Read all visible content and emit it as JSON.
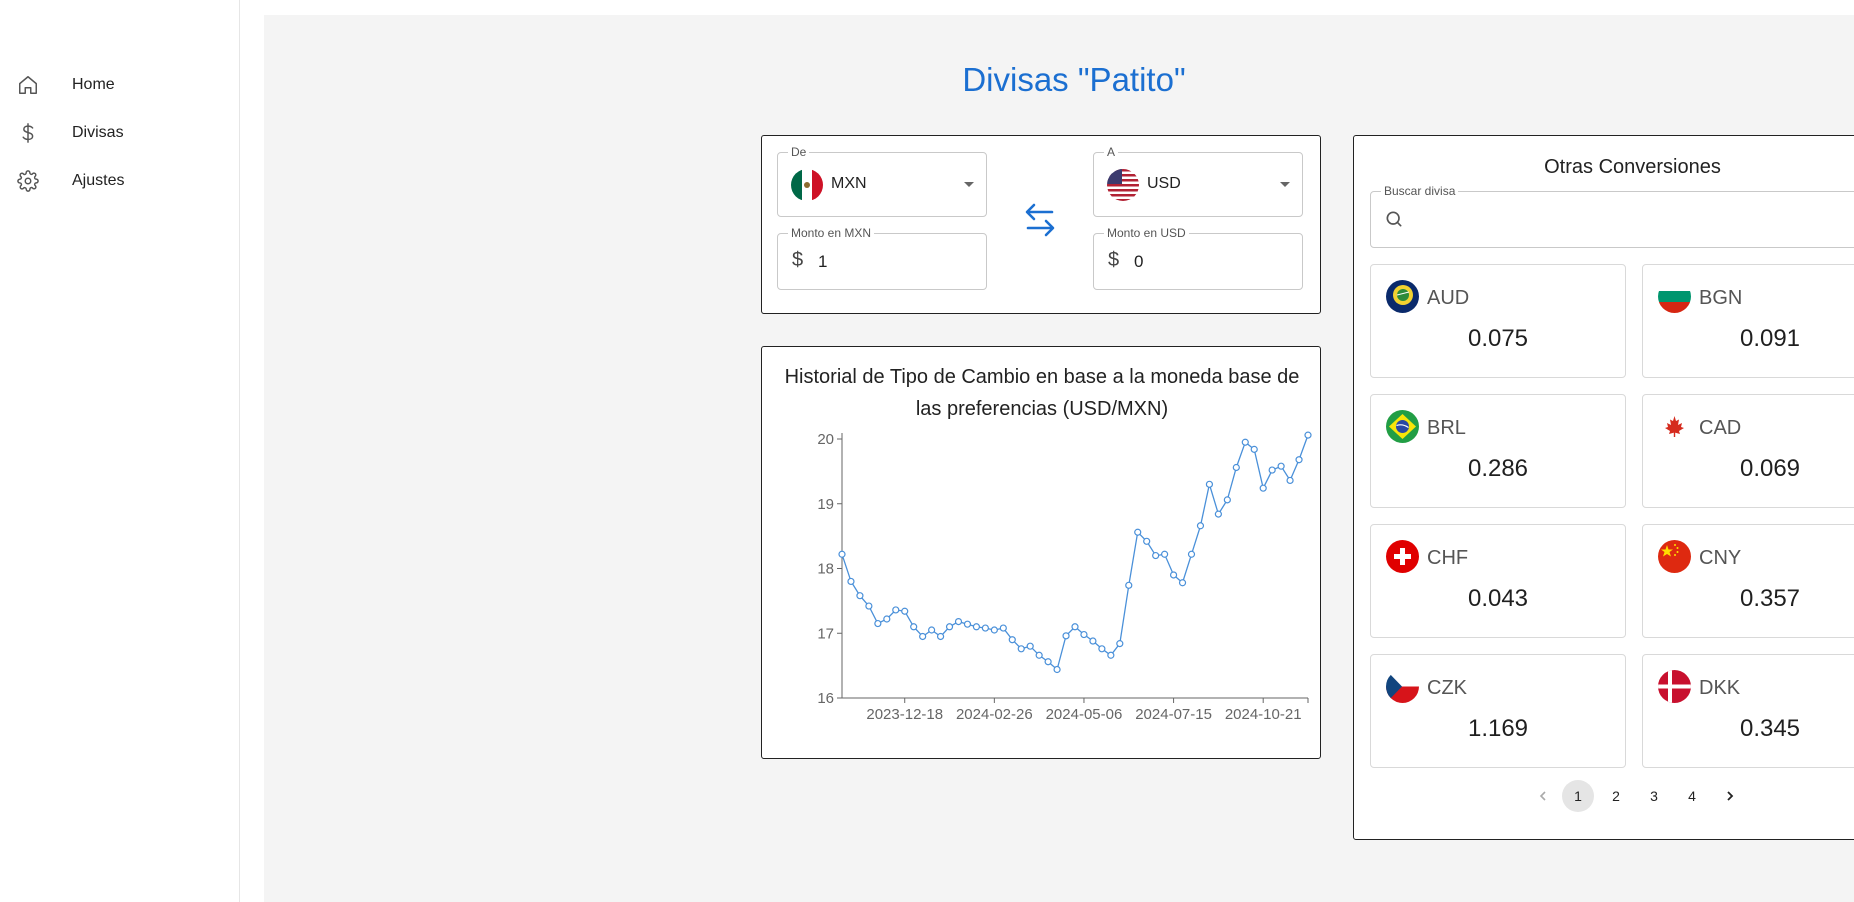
{
  "sidebar": {
    "items": [
      {
        "label": "Home",
        "icon": "home-icon"
      },
      {
        "label": "Divisas",
        "icon": "dollar-icon"
      },
      {
        "label": "Ajustes",
        "icon": "gear-icon"
      }
    ]
  },
  "page_title": "Divisas \"Patito\"",
  "converter": {
    "from": {
      "label": "De",
      "code": "MXN",
      "flag": "mexico-flag"
    },
    "to": {
      "label": "A",
      "code": "USD",
      "flag": "usa-flag"
    },
    "from_amount": {
      "label": "Monto en MXN",
      "symbol": "$",
      "value": "1"
    },
    "to_amount": {
      "label": "Monto en USD",
      "symbol": "$",
      "value": "0"
    },
    "swap_icon": "swap-arrows-icon"
  },
  "history": {
    "title_line1": "Historial de Tipo de Cambio en base a la moneda base de",
    "title_line2": "las preferencias (USD/MXN)"
  },
  "chart_data": {
    "type": "line",
    "title": "Historial de Tipo de Cambio en base a la moneda base de las preferencias (USD/MXN)",
    "xlabel": "",
    "ylabel": "",
    "ylim": [
      16,
      20
    ],
    "yticks": [
      "16",
      "17",
      "18",
      "19",
      "20"
    ],
    "xtick_labels": [
      "2023-12-18",
      "2024-02-26",
      "2024-05-06",
      "2024-07-15",
      "2024-10-21"
    ],
    "xtick_index": [
      7,
      17,
      27,
      37,
      47
    ],
    "series": [
      {
        "color": "#4a90d9",
        "values": [
          18.22,
          17.8,
          17.58,
          17.42,
          17.15,
          17.22,
          17.36,
          17.34,
          17.1,
          16.95,
          17.05,
          16.95,
          17.1,
          17.18,
          17.14,
          17.1,
          17.08,
          17.05,
          17.08,
          16.9,
          16.76,
          16.8,
          16.66,
          16.56,
          16.44,
          16.96,
          17.1,
          16.98,
          16.88,
          16.76,
          16.66,
          16.84,
          17.74,
          18.56,
          18.42,
          18.2,
          18.22,
          17.9,
          17.78,
          18.22,
          18.66,
          19.3,
          18.84,
          19.06,
          19.56,
          19.95,
          19.84,
          19.24,
          19.52,
          19.58,
          19.36,
          19.68,
          20.06
        ]
      }
    ],
    "grid": false
  },
  "other_conversions": {
    "title": "Otras Conversiones",
    "search": {
      "label": "Buscar divisa",
      "value": "",
      "placeholder": ""
    },
    "tiles": [
      {
        "code": "AUD",
        "value": "0.075",
        "flag": "australia-flag"
      },
      {
        "code": "BGN",
        "value": "0.091",
        "flag": "bulgaria-flag"
      },
      {
        "code": "BRL",
        "value": "0.286",
        "flag": "brazil-flag"
      },
      {
        "code": "CAD",
        "value": "0.069",
        "flag": "canada-flag"
      },
      {
        "code": "CHF",
        "value": "0.043",
        "flag": "switzerland-flag"
      },
      {
        "code": "CNY",
        "value": "0.357",
        "flag": "china-flag"
      },
      {
        "code": "CZK",
        "value": "1.169",
        "flag": "czech-flag"
      },
      {
        "code": "DKK",
        "value": "0.345",
        "flag": "denmark-flag"
      }
    ],
    "pagination": {
      "pages": [
        "1",
        "2",
        "3",
        "4"
      ],
      "current": "1"
    }
  }
}
